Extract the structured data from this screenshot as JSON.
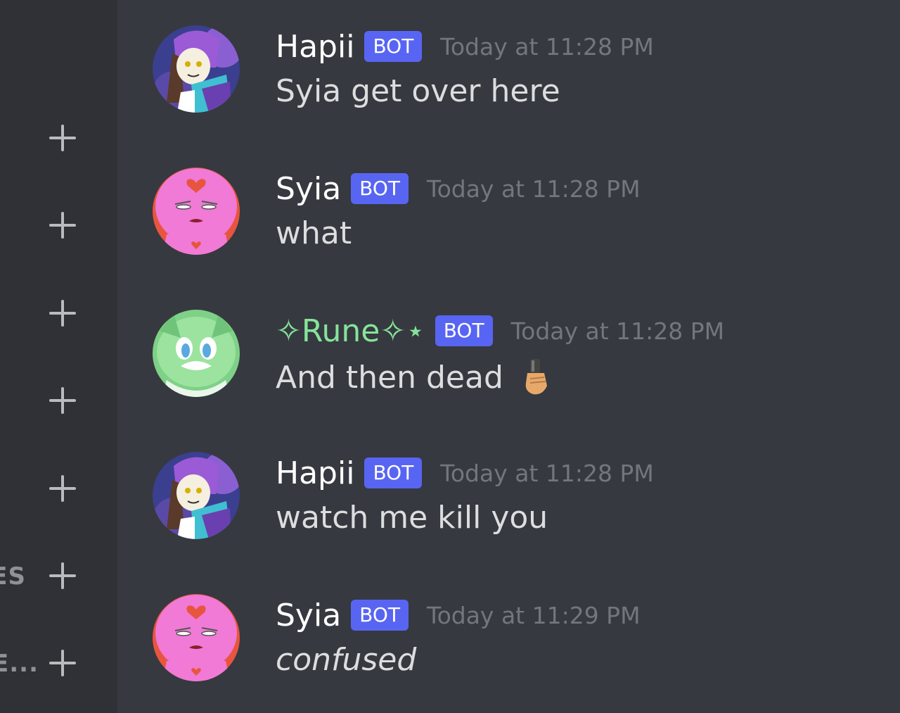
{
  "sidebar": {
    "rows": [
      {
        "label": "",
        "add_icon": "plus-icon"
      },
      {
        "label": "",
        "add_icon": "plus-icon"
      },
      {
        "label": "",
        "add_icon": "plus-icon"
      },
      {
        "label": "",
        "add_icon": "plus-icon"
      },
      {
        "label": "",
        "add_icon": "plus-icon"
      },
      {
        "label": "ES",
        "add_icon": "plus-icon"
      },
      {
        "label": "E...",
        "add_icon": "plus-icon"
      }
    ]
  },
  "messages": [
    {
      "username": "Hapii",
      "tag": "BOT",
      "timestamp": "Today at 11:28 PM",
      "content": "Syia get over here",
      "avatar": "hapii-avatar"
    },
    {
      "username": "Syia",
      "tag": "BOT",
      "timestamp": "Today at 11:28 PM",
      "content": "what",
      "avatar": "syia-avatar"
    },
    {
      "username": "✧Rune✧⋆",
      "tag": "BOT",
      "timestamp": "Today at 11:28 PM",
      "content": "And then dead",
      "avatar": "rune-avatar",
      "emoji": "gun-hand-emoji",
      "name_color": "#86e39b"
    },
    {
      "username": "Hapii",
      "tag": "BOT",
      "timestamp": "Today at 11:28 PM",
      "content": "watch me kill you",
      "avatar": "hapii-avatar"
    },
    {
      "username": "Syia",
      "tag": "BOT",
      "timestamp": "Today at 11:29 PM",
      "content": "confused",
      "avatar": "syia-avatar",
      "italic": true
    }
  ],
  "colors": {
    "background": "#36393f",
    "sidebar": "#2f3136",
    "bot_tag": "#5865f2",
    "timestamp": "#72767d",
    "message_text": "#dcddde"
  }
}
